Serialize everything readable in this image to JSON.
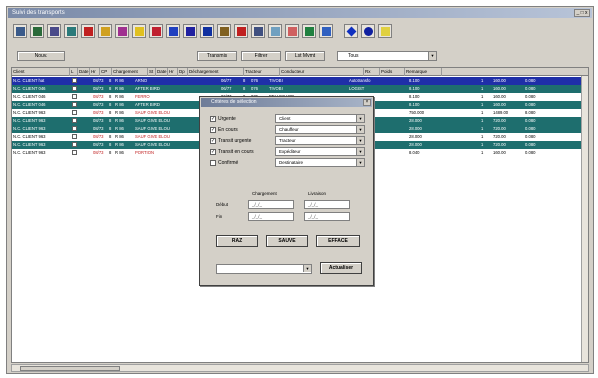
{
  "window": {
    "title": "Suivi des transports",
    "controls": "_ □ x"
  },
  "toolbar": {
    "icons": [
      {
        "name": "print-icon",
        "color": "#3a5a8a"
      },
      {
        "name": "preview-icon",
        "color": "#2a6a3a"
      },
      {
        "name": "document-icon",
        "color": "#4a4a8a"
      },
      {
        "name": "copy-icon",
        "color": "#2a7a7a"
      },
      {
        "name": "delete-icon",
        "color": "#c02020"
      },
      {
        "name": "truck-icon",
        "color": "#d0a020"
      },
      {
        "name": "wrench-icon",
        "color": "#a03090"
      },
      {
        "name": "sun-icon",
        "color": "#e0c020"
      },
      {
        "name": "flag-icon",
        "color": "#c02030"
      },
      {
        "name": "chart-icon",
        "color": "#2040c0"
      },
      {
        "name": "minus-icon",
        "color": "#2020a0"
      },
      {
        "name": "check-icon",
        "color": "#1030a0"
      },
      {
        "name": "stamp-icon",
        "color": "#806020"
      },
      {
        "name": "cross-icon",
        "color": "#c02020"
      },
      {
        "name": "book-icon",
        "color": "#405080"
      },
      {
        "name": "calendar-icon",
        "color": "#70a0c0"
      },
      {
        "name": "calculator-icon",
        "color": "#d06060"
      },
      {
        "name": "tools-icon",
        "color": "#208040"
      },
      {
        "name": "graph-icon",
        "color": "#3060c0"
      },
      {
        "name": "diamond-icon",
        "color": "#1030c0"
      },
      {
        "name": "help-icon",
        "color": "#1020a0"
      },
      {
        "name": "note-icon",
        "color": "#e0d040"
      }
    ]
  },
  "actions": {
    "new_label": "Nouv.",
    "btn2_label": "Transmis",
    "btn3_label": "Filtrer",
    "btn4_label": "Lst Mvmt",
    "filter_value": "Tous"
  },
  "grid": {
    "columns": [
      "Client",
      "L",
      "Date",
      "Hr",
      "CP",
      "Chargement",
      "St",
      "Date",
      "Hr",
      "Dp",
      "Déchargement",
      "Tracteur",
      "Conducteur",
      "Rx",
      "Poids",
      "Remarque"
    ],
    "rows": [
      {
        "bg": "#1f2fa8",
        "fg": "#ffffff",
        "cells": [
          "N.C. CLIENT hat",
          "08/73",
          "8",
          "R 86",
          "ARNO",
          "06/77",
          "8",
          "076",
          "TIVOBI",
          "Autotransfo",
          "8.100",
          "1",
          "160.00",
          "0.080"
        ]
      },
      {
        "bg": "#1e6e6e",
        "fg": "#ffffff",
        "cells": [
          "N.C. CLIENT 046",
          "08/73",
          "8",
          "R 86",
          "AFTER BIRD",
          "06/77",
          "8",
          "076",
          "TIVOBI",
          "LOGIST",
          "8.100",
          "1",
          "160.00",
          "0.080"
        ]
      },
      {
        "bg": "#ffffff",
        "fg": "#000000",
        "cells": [
          "N.C. CLIENT 046",
          "08/73",
          "8",
          "R 86",
          "FERRO",
          "06/77",
          "8",
          "076",
          "BELLEGARD",
          "",
          "8.100",
          "1",
          "160.00",
          "0.080"
        ]
      },
      {
        "bg": "#1e6e6e",
        "fg": "#ffffff",
        "cells": [
          "N.C. CLIENT 046",
          "08/73",
          "8",
          "R 86",
          "AFTER BIRD",
          "06/77",
          "8",
          "076",
          "TIVOBI",
          "",
          "8.100",
          "1",
          "160.00",
          "0.080"
        ]
      },
      {
        "bg": "#ffffff",
        "fg": "#000000",
        "cells": [
          "N.C. CLIENT 963",
          "08/73",
          "8",
          "R 86",
          "SAUF GIVE ELOU",
          "06/77",
          "8",
          "076",
          "FERSONNES",
          "",
          "750.000",
          "1",
          "1489.00",
          "8.080"
        ]
      },
      {
        "bg": "#1e6e6e",
        "fg": "#ffffff",
        "cells": [
          "N.C. CLIENT 963",
          "08/73",
          "8",
          "R 86",
          "SAUF GIVE ELOU",
          "06/77",
          "8",
          "076",
          "SAUF GIVE ELOU",
          "",
          "28.000",
          "1",
          "720.00",
          "0.080"
        ]
      },
      {
        "bg": "#1e6e6e",
        "fg": "#ffffff",
        "cells": [
          "N.C. CLIENT 963",
          "08/73",
          "8",
          "R 86",
          "SAUF GIVE ELOU",
          "06/77",
          "8",
          "076",
          "SAUF GIVE ELOU",
          "",
          "28.000",
          "1",
          "720.00",
          "0.080"
        ]
      },
      {
        "bg": "#ffffff",
        "fg": "#000000",
        "cells": [
          "N.C. CLIENT 963",
          "08/73",
          "8",
          "R 86",
          "SAUF GIVE ELOU",
          "06/77",
          "8",
          "076",
          "SAUF GIVE ELOU",
          "",
          "28.000",
          "1",
          "720.00",
          "0.080"
        ]
      },
      {
        "bg": "#1e6e6e",
        "fg": "#ffffff",
        "cells": [
          "N.C. CLIENT 963",
          "08/73",
          "8",
          "R 86",
          "SAUF GIVE ELOU",
          "06/77",
          "8",
          "076",
          "SAUF GIVE ELOU",
          "",
          "28.000",
          "1",
          "720.00",
          "0.080"
        ]
      },
      {
        "bg": "#ffffff",
        "fg": "#000000",
        "cells": [
          "N.C. CLIENT 963",
          "08/73",
          "8",
          "R 86",
          "PORTION",
          "06/77",
          "8",
          "076",
          "SAUF GIVE ELOU",
          "",
          "8.040",
          "1",
          "160.00",
          "0.080"
        ]
      }
    ]
  },
  "dialog": {
    "title": "Critères de sélection",
    "checks": [
      {
        "label": "Urgente",
        "checked": true
      },
      {
        "label": "En cours",
        "checked": true
      },
      {
        "label": "Transit urgente",
        "checked": true
      },
      {
        "label": "Transit en cours",
        "checked": true
      },
      {
        "label": "Confirmé",
        "checked": false
      }
    ],
    "selects": [
      "Client",
      "Chauffeur",
      "Tracteur",
      "Expéditeur",
      "Destinataire"
    ],
    "group1_label": "Chargement",
    "group2_label": "Livraison",
    "row1_label": "Début",
    "row2_label": "Fin",
    "date_placeholder": "_/_/_",
    "btn_raz": "RAZ",
    "btn_save": "SAUVE",
    "btn_clear": "EFFACE",
    "bottom_select": "",
    "btn_update": "Actualiser"
  }
}
